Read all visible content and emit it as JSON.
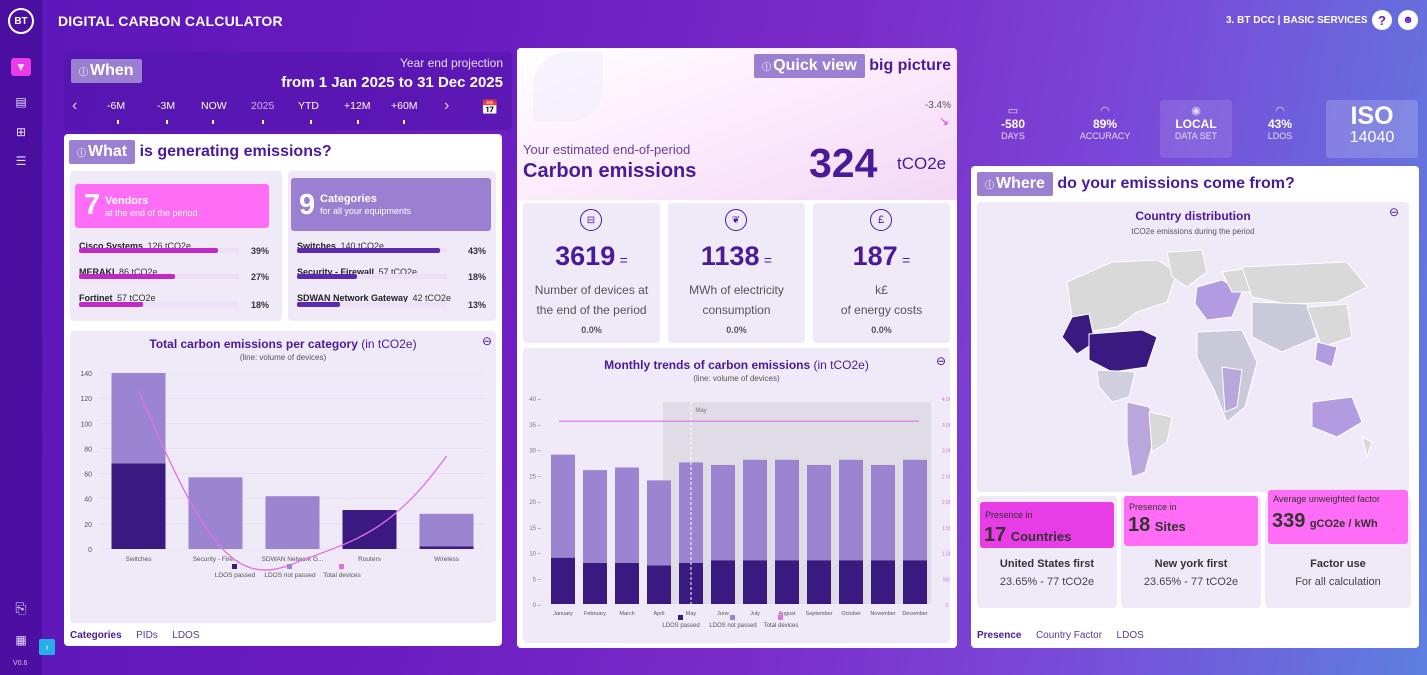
{
  "app": {
    "logo": "BT",
    "title": "DIGITAL CARBON CALCULATOR",
    "account": "3. BT DCC | BASIC SERVICES",
    "version": "V0.6"
  },
  "colors": {
    "accent": "#4a1a99",
    "pink": "#e83de6",
    "lavender": "#9b7fd0",
    "dark": "#3a1a80"
  },
  "when": {
    "chip": "When",
    "projection_label": "Year end projection",
    "range": "from 1 Jan 2025 to 31 Dec 2025",
    "timeline": [
      "-6M",
      "-3M",
      "NOW",
      "2025",
      "YTD",
      "+12M",
      "+60M"
    ],
    "active": "2025"
  },
  "what": {
    "chip": "What",
    "title": "is generating emissions?",
    "vendors": {
      "count": "7",
      "label": "Vendors",
      "sub": "at the end of the period",
      "items": [
        {
          "name": "Cisco Systems",
          "val": "126 tCO2e",
          "pct": "39%",
          "frac": 0.39
        },
        {
          "name": "MERAKI",
          "val": "86 tCO2e",
          "pct": "27%",
          "frac": 0.27
        },
        {
          "name": "Fortinet",
          "val": "57 tCO2e",
          "pct": "18%",
          "frac": 0.18
        }
      ]
    },
    "categories": {
      "count": "9",
      "label": "Categories",
      "sub": "for all your equipments",
      "items": [
        {
          "name": "Switches",
          "val": "140 tCO2e",
          "pct": "43%",
          "frac": 0.43
        },
        {
          "name": "Security - Firewall",
          "val": "57 tCO2e",
          "pct": "18%",
          "frac": 0.18
        },
        {
          "name": "SDWAN Network Gateway",
          "val": "42 tCO2e",
          "pct": "13%",
          "frac": 0.13
        }
      ]
    },
    "chart_title": "Total carbon emissions per category",
    "chart_unit": "(in tCO2e)",
    "chart_sub": "(line: volume of devices)",
    "tabs": [
      "Categories",
      "PIDs",
      "LDOS"
    ]
  },
  "quick": {
    "chip": "Quick view",
    "title": "big picture",
    "delta": "-3.4%",
    "est_label": "Your estimated end-of-period",
    "est_title": "Carbon emissions",
    "value": "324",
    "unit": "tCO2e",
    "stats": [
      {
        "icon": "device-icon",
        "value": "3619",
        "eq": "=",
        "label1": "Number of devices at",
        "label2": "the end of the period",
        "change": "0.0%"
      },
      {
        "icon": "leaf-icon",
        "value": "1138",
        "eq": "=",
        "label1": "MWh of electricity",
        "label2": "consumption",
        "change": "0.0%"
      },
      {
        "icon": "pound-icon",
        "value": "187",
        "eq": "=",
        "label1": "k£",
        "label2": "of energy costs",
        "change": "0.0%"
      }
    ],
    "chart_title": "Monthly trends of carbon emissions",
    "chart_unit": "(in tCO2e)",
    "chart_sub": "(line: volume of devices)",
    "marker": "May"
  },
  "top_stats": [
    {
      "v": "-580",
      "l": "DAYS"
    },
    {
      "v": "89%",
      "l": "ACCURACY"
    },
    {
      "v": "LOCAL",
      "l": "DATA SET"
    },
    {
      "v": "43%",
      "l": "LDOS"
    }
  ],
  "iso": {
    "a": "ISO",
    "b": "14040"
  },
  "where": {
    "chip": "Where",
    "title": "do your emissions come from?",
    "map_title": "Country distribution",
    "map_sub": "tCO2e emissions during the period",
    "cards": [
      {
        "top": "Presence in",
        "big": "17",
        "big_unit": "Countries",
        "sub1": "United States first",
        "sub2": "23.65% - 77 tCO2e"
      },
      {
        "top": "Presence in",
        "big": "18",
        "big_unit": "Sites",
        "sub1": "New york first",
        "sub2": "23.65% - 77 tCO2e"
      },
      {
        "top": "Average unweighted factor",
        "big": "339",
        "big_unit": "gCO2e / kWh",
        "sub1": "Factor use",
        "sub2": "For all calculation"
      }
    ],
    "tabs": [
      "Presence",
      "Country Factor",
      "LDOS"
    ]
  },
  "chart_data": [
    {
      "type": "bar",
      "title": "Total carbon emissions per category",
      "categories": [
        "Switches",
        "Security - Fire...",
        "SDWAN Network G...",
        "Routers",
        "Wireless"
      ],
      "series": [
        {
          "name": "LDOS passed",
          "values": [
            68,
            0,
            0,
            31,
            2
          ]
        },
        {
          "name": "LDOS not passed",
          "values": [
            72,
            57,
            42,
            0,
            26
          ]
        }
      ],
      "line": {
        "name": "Total devices"
      },
      "ylim": [
        0,
        140
      ],
      "yticks": [
        0,
        20,
        40,
        60,
        80,
        100,
        120,
        140
      ],
      "legend": "bottom"
    },
    {
      "type": "bar",
      "title": "Monthly trends of carbon emissions",
      "categories": [
        "January",
        "February",
        "March",
        "April",
        "May",
        "June",
        "July",
        "August",
        "September",
        "October",
        "November",
        "December"
      ],
      "series": [
        {
          "name": "LDOS passed",
          "values": [
            9,
            8,
            8,
            7.5,
            8,
            8.5,
            8.5,
            8.5,
            8.5,
            8.5,
            8.5,
            8.5
          ]
        },
        {
          "name": "LDOS not passed",
          "values": [
            20,
            18,
            18.5,
            16.5,
            19.5,
            18.5,
            19.5,
            19.5,
            18.5,
            19.5,
            18.5,
            19.5
          ]
        }
      ],
      "line": {
        "name": "Total devices"
      },
      "ylim": [
        0,
        40
      ],
      "yticks": [
        0,
        5,
        10,
        15,
        20,
        25,
        30,
        35,
        40
      ],
      "y2ticks": [
        "0",
        "500",
        "1.0K",
        "1.5K",
        "2.0K",
        "2.5K",
        "3.0K",
        "3.5K",
        "4.0K"
      ],
      "legend": "bottom"
    }
  ]
}
